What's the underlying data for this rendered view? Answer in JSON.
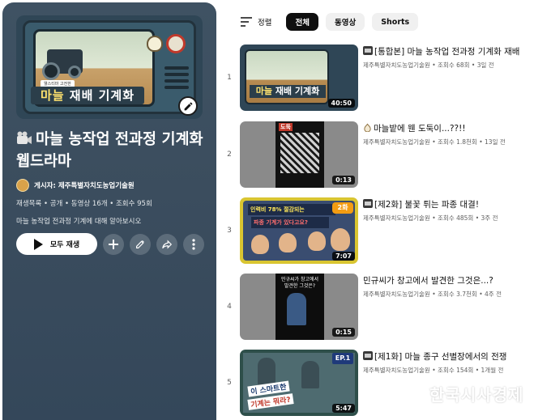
{
  "playlist": {
    "cover_tag": "웰스티마 고전한",
    "cover_title_highlight": "마늘",
    "cover_title_rest": " 재배 기계화",
    "title": "마늘 농작업 전과정 기계화 웹드라마",
    "owner_label": "게시자: 제주특별자치도농업기술원",
    "meta": "재생목록 • 공개 • 동영상 16개 • 조회수 95회",
    "description": "마늘 농작업 전과정 기계에 대해 알아보시오",
    "play_all_label": "모두 재생",
    "icons": [
      "add-icon",
      "edit-icon",
      "share-icon",
      "more-icon"
    ]
  },
  "filters": {
    "sort_label": "정렬",
    "chips": [
      "전체",
      "동영상",
      "Shorts"
    ],
    "active": "전체"
  },
  "videos": [
    {
      "index": "1",
      "title": "[통합본] 마늘 농작업 전과정 기계화 재배",
      "channel": "제주특별자치도농업기술원",
      "views": "조회수 68회",
      "age": "3일 전",
      "duration": "40:50"
    },
    {
      "index": "2",
      "title": "마늘밭에 웬 도둑이...??!!",
      "channel": "제주특별자치도농업기술원",
      "views": "조회수 1.8천회",
      "age": "13일 전",
      "duration": "0:13",
      "thumb_caption": "도둑"
    },
    {
      "index": "3",
      "title": "[제2화] 불꽃 튀는 파종 대결!",
      "channel": "제주특별자치도농업기술원",
      "views": "조회수 485회",
      "age": "3주 전",
      "duration": "7:07",
      "thumb_caption": "인력비 78% 절감되는",
      "thumb_caption2": "파종 기계가 있다고요?",
      "thumb_badge": "2화"
    },
    {
      "index": "4",
      "title": "민규씨가 창고에서 발견한 그것은...?",
      "channel": "제주특별자치도농업기술원",
      "views": "조회수 3.7천회",
      "age": "4주 전",
      "duration": "0:15",
      "thumb_caption": "민규씨가 창고에서 발견한 그것은?"
    },
    {
      "index": "5",
      "title": "[제1화] 마늘 종구 선별장에서의 전쟁",
      "channel": "제주특별자치도농업기술원",
      "views": "조회수 154회",
      "age": "1개월 전",
      "duration": "5:47",
      "thumb_caption": "이 스마트한",
      "thumb_caption2": "기계는 뭐라?",
      "thumb_badge": "EP.1"
    }
  ],
  "watermark": "한국시사경제",
  "colors": {
    "sidebar": "#3b4d5e",
    "accent_yellow": "#ffe36e"
  }
}
